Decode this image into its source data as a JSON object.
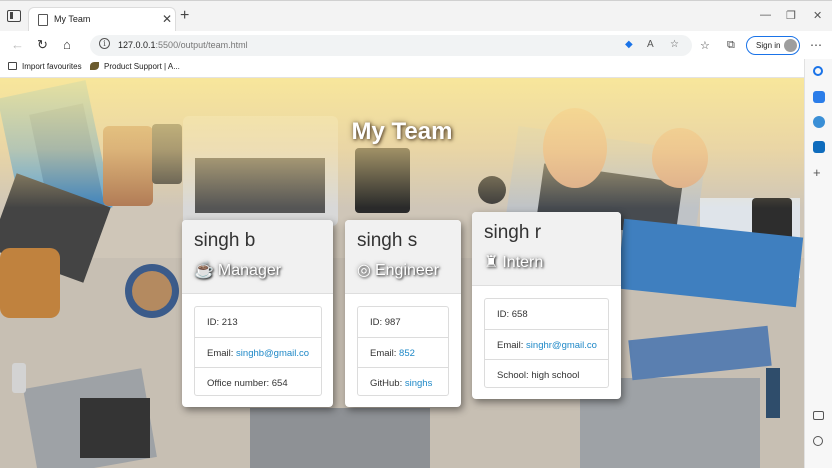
{
  "browser": {
    "tab_title": "My Team",
    "tab_close": "✕",
    "new_tab": "+",
    "url_host": "127.0.0.1",
    "url_path": ":5500/output/team.html",
    "sign_in": "Sign in",
    "favourites": [
      {
        "label": "Import favourites"
      },
      {
        "label": "Product Support | A..."
      }
    ],
    "window_controls": {
      "minimize": "—",
      "restore": "❐",
      "close": "✕"
    }
  },
  "page": {
    "title": "My Team"
  },
  "cards": [
    {
      "name": "singh b",
      "role": "Manager",
      "role_icon": "mug-icon",
      "rows": [
        {
          "label": "ID: 213",
          "link": ""
        },
        {
          "label": "Email: ",
          "link": "singhb@gmail.co"
        },
        {
          "label": "Office number: 654",
          "link": ""
        }
      ]
    },
    {
      "name": "singh s",
      "role": "Engineer",
      "role_icon": "glasses-icon",
      "rows": [
        {
          "label": "ID: 987",
          "link": ""
        },
        {
          "label": "Email: ",
          "link": "852"
        },
        {
          "label": "GitHub: ",
          "link": "singhs"
        }
      ]
    },
    {
      "name": "singh r",
      "role": "Intern",
      "role_icon": "graduate-icon",
      "rows": [
        {
          "label": "ID: 658",
          "link": ""
        },
        {
          "label": "Email: ",
          "link": "singhr@gmail.co"
        },
        {
          "label": "School: high school",
          "link": ""
        }
      ]
    }
  ],
  "colors": {
    "link": "#1e88c7",
    "header_bg": "#f1f1f1",
    "hero_tint": "#ffe896"
  }
}
